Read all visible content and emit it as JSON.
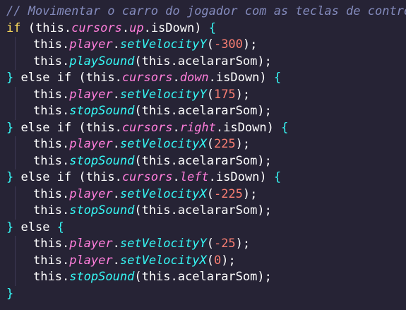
{
  "code": {
    "lines": [
      {
        "indent": false,
        "tokens": [
          {
            "c": "comment",
            "t": "// Movimentar o carro do jogador com as teclas de controle"
          }
        ]
      },
      {
        "indent": false,
        "tokens": [
          {
            "c": "kw",
            "t": "if"
          },
          {
            "c": "punct",
            "t": " ("
          },
          {
            "c": "punct",
            "t": "this"
          },
          {
            "c": "punct",
            "t": "."
          },
          {
            "c": "prop",
            "t": "cursors"
          },
          {
            "c": "punct",
            "t": "."
          },
          {
            "c": "prop",
            "t": "up"
          },
          {
            "c": "punct",
            "t": "."
          },
          {
            "c": "punct",
            "t": "isDown"
          },
          {
            "c": "punct",
            "t": ") "
          },
          {
            "c": "brace",
            "t": "{"
          }
        ]
      },
      {
        "indent": true,
        "tokens": [
          {
            "c": "punct",
            "t": "this"
          },
          {
            "c": "punct",
            "t": "."
          },
          {
            "c": "prop",
            "t": "player"
          },
          {
            "c": "punct",
            "t": "."
          },
          {
            "c": "fn",
            "t": "setVelocityY"
          },
          {
            "c": "punct",
            "t": "("
          },
          {
            "c": "num",
            "t": "-300"
          },
          {
            "c": "punct",
            "t": ");"
          }
        ]
      },
      {
        "indent": true,
        "tokens": [
          {
            "c": "punct",
            "t": "this"
          },
          {
            "c": "punct",
            "t": "."
          },
          {
            "c": "fn",
            "t": "playSound"
          },
          {
            "c": "punct",
            "t": "("
          },
          {
            "c": "punct",
            "t": "this"
          },
          {
            "c": "punct",
            "t": "."
          },
          {
            "c": "punct",
            "t": "acelararSom"
          },
          {
            "c": "punct",
            "t": ");"
          }
        ]
      },
      {
        "indent": false,
        "tokens": [
          {
            "c": "brace",
            "t": "}"
          },
          {
            "c": "punct",
            "t": " else if ("
          },
          {
            "c": "punct",
            "t": "this"
          },
          {
            "c": "punct",
            "t": "."
          },
          {
            "c": "prop",
            "t": "cursors"
          },
          {
            "c": "punct",
            "t": "."
          },
          {
            "c": "prop",
            "t": "down"
          },
          {
            "c": "punct",
            "t": "."
          },
          {
            "c": "punct",
            "t": "isDown"
          },
          {
            "c": "punct",
            "t": ") "
          },
          {
            "c": "brace",
            "t": "{"
          }
        ]
      },
      {
        "indent": true,
        "tokens": [
          {
            "c": "punct",
            "t": "this"
          },
          {
            "c": "punct",
            "t": "."
          },
          {
            "c": "prop",
            "t": "player"
          },
          {
            "c": "punct",
            "t": "."
          },
          {
            "c": "fn",
            "t": "setVelocityY"
          },
          {
            "c": "punct",
            "t": "("
          },
          {
            "c": "num",
            "t": "175"
          },
          {
            "c": "punct",
            "t": ");"
          }
        ]
      },
      {
        "indent": true,
        "tokens": [
          {
            "c": "punct",
            "t": "this"
          },
          {
            "c": "punct",
            "t": "."
          },
          {
            "c": "fn",
            "t": "stopSound"
          },
          {
            "c": "punct",
            "t": "("
          },
          {
            "c": "punct",
            "t": "this"
          },
          {
            "c": "punct",
            "t": "."
          },
          {
            "c": "punct",
            "t": "acelararSom"
          },
          {
            "c": "punct",
            "t": ");"
          }
        ]
      },
      {
        "indent": false,
        "tokens": [
          {
            "c": "brace",
            "t": "}"
          },
          {
            "c": "punct",
            "t": " else if ("
          },
          {
            "c": "punct",
            "t": "this"
          },
          {
            "c": "punct",
            "t": "."
          },
          {
            "c": "prop",
            "t": "cursors"
          },
          {
            "c": "punct",
            "t": "."
          },
          {
            "c": "prop",
            "t": "right"
          },
          {
            "c": "punct",
            "t": "."
          },
          {
            "c": "punct",
            "t": "isDown"
          },
          {
            "c": "punct",
            "t": ") "
          },
          {
            "c": "brace",
            "t": "{"
          }
        ]
      },
      {
        "indent": true,
        "tokens": [
          {
            "c": "punct",
            "t": "this"
          },
          {
            "c": "punct",
            "t": "."
          },
          {
            "c": "prop",
            "t": "player"
          },
          {
            "c": "punct",
            "t": "."
          },
          {
            "c": "fn",
            "t": "setVelocityX"
          },
          {
            "c": "punct",
            "t": "("
          },
          {
            "c": "num",
            "t": "225"
          },
          {
            "c": "punct",
            "t": ");"
          }
        ]
      },
      {
        "indent": true,
        "tokens": [
          {
            "c": "punct",
            "t": "this"
          },
          {
            "c": "punct",
            "t": "."
          },
          {
            "c": "fn",
            "t": "stopSound"
          },
          {
            "c": "punct",
            "t": "("
          },
          {
            "c": "punct",
            "t": "this"
          },
          {
            "c": "punct",
            "t": "."
          },
          {
            "c": "punct",
            "t": "acelararSom"
          },
          {
            "c": "punct",
            "t": ");"
          }
        ]
      },
      {
        "indent": false,
        "tokens": [
          {
            "c": "brace",
            "t": "}"
          },
          {
            "c": "punct",
            "t": " else if ("
          },
          {
            "c": "punct",
            "t": "this"
          },
          {
            "c": "punct",
            "t": "."
          },
          {
            "c": "prop",
            "t": "cursors"
          },
          {
            "c": "punct",
            "t": "."
          },
          {
            "c": "prop",
            "t": "left"
          },
          {
            "c": "punct",
            "t": "."
          },
          {
            "c": "punct",
            "t": "isDown"
          },
          {
            "c": "punct",
            "t": ") "
          },
          {
            "c": "brace",
            "t": "{"
          }
        ]
      },
      {
        "indent": true,
        "tokens": [
          {
            "c": "punct",
            "t": "this"
          },
          {
            "c": "punct",
            "t": "."
          },
          {
            "c": "prop",
            "t": "player"
          },
          {
            "c": "punct",
            "t": "."
          },
          {
            "c": "fn",
            "t": "setVelocityX"
          },
          {
            "c": "punct",
            "t": "("
          },
          {
            "c": "num",
            "t": "-225"
          },
          {
            "c": "punct",
            "t": ");"
          }
        ]
      },
      {
        "indent": true,
        "tokens": [
          {
            "c": "punct",
            "t": "this"
          },
          {
            "c": "punct",
            "t": "."
          },
          {
            "c": "fn",
            "t": "stopSound"
          },
          {
            "c": "punct",
            "t": "("
          },
          {
            "c": "punct",
            "t": "this"
          },
          {
            "c": "punct",
            "t": "."
          },
          {
            "c": "punct",
            "t": "acelararSom"
          },
          {
            "c": "punct",
            "t": ");"
          }
        ]
      },
      {
        "indent": false,
        "tokens": [
          {
            "c": "brace",
            "t": "}"
          },
          {
            "c": "punct",
            "t": " else "
          },
          {
            "c": "brace",
            "t": "{"
          }
        ]
      },
      {
        "indent": true,
        "tokens": [
          {
            "c": "punct",
            "t": "this"
          },
          {
            "c": "punct",
            "t": "."
          },
          {
            "c": "prop",
            "t": "player"
          },
          {
            "c": "punct",
            "t": "."
          },
          {
            "c": "fn",
            "t": "setVelocityY"
          },
          {
            "c": "punct",
            "t": "("
          },
          {
            "c": "num",
            "t": "-25"
          },
          {
            "c": "punct",
            "t": ");"
          }
        ]
      },
      {
        "indent": true,
        "tokens": [
          {
            "c": "punct",
            "t": "this"
          },
          {
            "c": "punct",
            "t": "."
          },
          {
            "c": "prop",
            "t": "player"
          },
          {
            "c": "punct",
            "t": "."
          },
          {
            "c": "fn",
            "t": "setVelocityX"
          },
          {
            "c": "punct",
            "t": "("
          },
          {
            "c": "num",
            "t": "0"
          },
          {
            "c": "punct",
            "t": ");"
          }
        ]
      },
      {
        "indent": true,
        "tokens": [
          {
            "c": "punct",
            "t": "this"
          },
          {
            "c": "punct",
            "t": "."
          },
          {
            "c": "fn",
            "t": "stopSound"
          },
          {
            "c": "punct",
            "t": "("
          },
          {
            "c": "punct",
            "t": "this"
          },
          {
            "c": "punct",
            "t": "."
          },
          {
            "c": "punct",
            "t": "acelararSom"
          },
          {
            "c": "punct",
            "t": ");"
          }
        ]
      },
      {
        "indent": false,
        "tokens": [
          {
            "c": "brace",
            "t": "}"
          }
        ]
      }
    ]
  },
  "colors": {
    "background": "#262335",
    "comment": "#848bbd",
    "keyword": "#fede5d",
    "property": "#ff7edb",
    "function": "#36f9f6",
    "number": "#f97e72",
    "brace": "#36f9f6"
  }
}
